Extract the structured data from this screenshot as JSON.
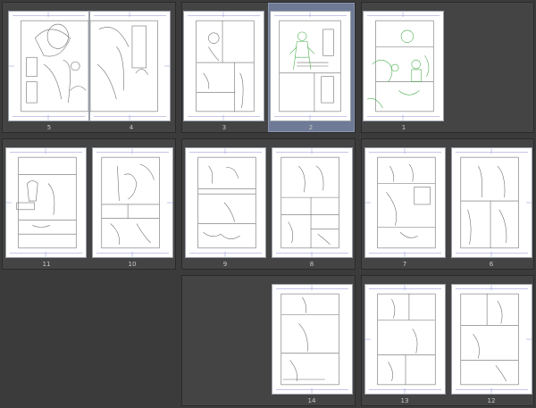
{
  "window": {
    "background": "#3b3b3b",
    "panel_background": "#444444",
    "selection_color": "#6f7a96",
    "sketch_color": "#6d6d6d",
    "green_sketch_color": "#4caf50",
    "guide_color": "#6a72c8"
  },
  "pages": [
    {
      "number": "5",
      "label": "5"
    },
    {
      "number": "4",
      "label": "4"
    },
    {
      "number": "3",
      "label": "3"
    },
    {
      "number": "2",
      "label": "2",
      "selected": true
    },
    {
      "number": "1",
      "label": "1"
    },
    {
      "number": "11",
      "label": "11"
    },
    {
      "number": "10",
      "label": "10"
    },
    {
      "number": "9",
      "label": "9"
    },
    {
      "number": "8",
      "label": "8"
    },
    {
      "number": "7",
      "label": "7"
    },
    {
      "number": "6",
      "label": "6"
    },
    {
      "number": "14",
      "label": "14"
    },
    {
      "number": "13",
      "label": "13"
    },
    {
      "number": "12",
      "label": "12"
    }
  ]
}
